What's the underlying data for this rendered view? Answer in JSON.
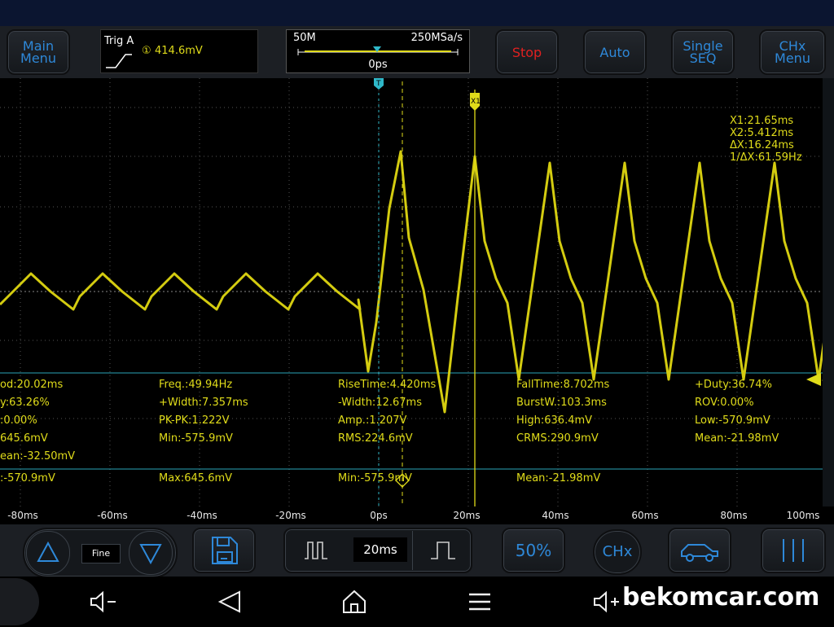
{
  "toolbar": {
    "main_menu": "Main\nMenu",
    "stop": "Stop",
    "auto": "Auto",
    "single_seq": "Single\nSEQ",
    "chx_menu": "CHx\nMenu"
  },
  "trigger": {
    "label": "Trig A",
    "channel": "①",
    "level": "414.6mV"
  },
  "timebase": {
    "memory": "50M",
    "sample_rate": "250MSa/s",
    "offset": "0ps"
  },
  "cursor_info": {
    "x1": "X1:21.65ms",
    "x2": "X2:5.412ms",
    "dx": "ΔX:16.24ms",
    "inv_dx": "1/ΔX:61.59Hz"
  },
  "markers": {
    "trigger_marker": "T",
    "cursor_x1": "X1"
  },
  "measurements": [
    [
      "od:20.02ms",
      "Freq.:49.94Hz",
      "RiseTime:4.420ms",
      "FallTime:8.702ms",
      "+Duty:36.74%"
    ],
    [
      "y:63.26%",
      "+Width:7.357ms",
      "-Width:12.67ms",
      "BurstW.:103.3ms",
      "ROV:0.00%"
    ],
    [
      ":0.00%",
      "PK-PK:1.222V",
      "Amp.:1.207V",
      "High:636.4mV",
      "Low:-570.9mV"
    ],
    [
      "645.6mV",
      "Min:-575.9mV",
      "RMS:224.6mV",
      "CRMS:290.9mV",
      "Mean:-21.98mV"
    ],
    [
      "ean:-32.50mV",
      "",
      "",
      "",
      ""
    ]
  ],
  "summary_row": [
    ":-570.9mV",
    "Max:645.6mV",
    "Min:-575.9mV",
    "Mean:-21.98mV"
  ],
  "x_axis": [
    "-80ms",
    "-60ms",
    "-40ms",
    "-20ms",
    "0ps",
    "20ms",
    "40ms",
    "60ms",
    "80ms",
    "100ms"
  ],
  "bottom": {
    "fine_label": "Fine",
    "timebase_value": "20ms",
    "fifty_label": "50%",
    "chx_label": "CHx"
  },
  "watermark": "bekomcar.com",
  "colors": {
    "trace": "#d4cc10",
    "accent": "#2e88d8",
    "stop": "#e02020",
    "cyan": "#2fb8c8"
  }
}
